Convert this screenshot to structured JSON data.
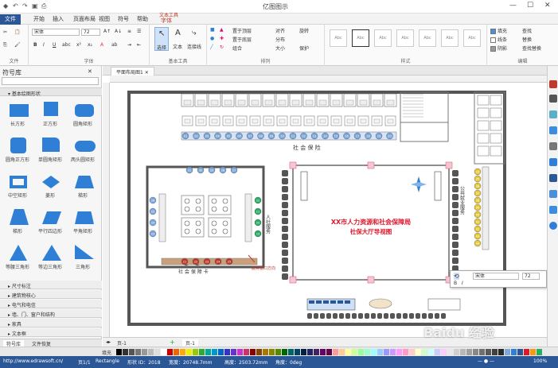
{
  "window": {
    "title": "亿图图示"
  },
  "tabs": [
    {
      "label": "文件"
    },
    {
      "label": "开始"
    },
    {
      "label": "插入"
    },
    {
      "label": "页面布局"
    },
    {
      "label": "视图"
    },
    {
      "label": "符号"
    },
    {
      "label": "帮助"
    },
    {
      "label": "文本工具"
    },
    {
      "label": "字体"
    }
  ],
  "ribbon": {
    "font_name": "宋体",
    "font_size": "72",
    "groups": {
      "clipboard": "文件",
      "font": "字体",
      "basic_tools": "基本工具",
      "arrange": "排列",
      "styles": "样式",
      "edit": "编辑"
    },
    "tools": {
      "select": "选择",
      "text": "文本",
      "connector": "连接线"
    },
    "arrange_items": [
      "置于顶层",
      "置于底层",
      "组合",
      "对齐",
      "分布",
      "大小",
      "旋转",
      "保护"
    ],
    "edit_items": [
      "查找",
      "替换",
      "选择",
      "查找替换",
      "编辑"
    ],
    "style_boxes": [
      "Abc",
      "Abc",
      "Abc",
      "Abc",
      "Abc",
      "Abc",
      "Abc"
    ]
  },
  "left_panel": {
    "title": "符号库",
    "open_category": "基本绘图形状",
    "shapes": [
      {
        "label": "长方形"
      },
      {
        "label": "正方形"
      },
      {
        "label": "圆角矩形"
      },
      {
        "label": "圆角正方形"
      },
      {
        "label": "单圆角矩形"
      },
      {
        "label": "两头圆矩形"
      },
      {
        "label": "中空矩形"
      },
      {
        "label": "菱形"
      },
      {
        "label": "梯形"
      },
      {
        "label": "梯形"
      },
      {
        "label": "平行四边形"
      },
      {
        "label": "平角矩形"
      },
      {
        "label": "等腰三角形"
      },
      {
        "label": "等边三角形"
      },
      {
        "label": "三角形"
      }
    ],
    "categories": [
      "尺寸标注",
      "建筑物核心",
      "电气和电信",
      "墙、门、窗户和结构",
      "家具",
      "文本框"
    ],
    "bottom_tabs": [
      "符号库",
      "文件恢复"
    ]
  },
  "document": {
    "tab": "平面布局图1"
  },
  "floorplan": {
    "main_title_1": "XX市人力资源和社会保障局",
    "main_title_2": "社保大厅导视图",
    "top_label": "社 会 保 险",
    "bottom_left_label": "社 会 保 障 卡",
    "side_label_left": "人社服务",
    "side_label_right": "公共就业服务",
    "seat_numbers_top": [
      "01",
      "02",
      "03",
      "04",
      "05",
      "06",
      "07",
      "08",
      "09",
      "10",
      "11",
      "12",
      "13",
      "14",
      "15",
      "16",
      "17",
      "18",
      "19",
      "20"
    ],
    "seat_numbers_inner": [
      "31",
      "30",
      "29",
      "28",
      "27",
      "26",
      "25",
      "24",
      "23",
      "22",
      "21",
      "20",
      "19",
      "18",
      "17"
    ],
    "seat_numbers_right": [
      "34",
      "35",
      "36",
      "37",
      "38",
      "39",
      "40",
      "41",
      "42",
      "43",
      "44"
    ],
    "arrow_label": "服务窗口方向"
  },
  "font_popup": {
    "font": "宋体",
    "size": "72"
  },
  "page_bar": {
    "page": "页-1",
    "add": "+",
    "page2": "页-1"
  },
  "status": {
    "url": "http://www.edrawsoft.cn/",
    "page": "页1/1",
    "shape": "Rectangle",
    "id": "形状 ID：2018",
    "width": "宽度：20748.7mm",
    "height": "高度：2503.72mm",
    "angle": "角度：0deg",
    "zoom": "100%"
  },
  "watermark": "Baidu 经验",
  "colors": {
    "accent": "#2b5797",
    "shape_blue": "#2f7fd6",
    "title_red": "#e0182d",
    "seat_blue": "#7fa7d8"
  }
}
